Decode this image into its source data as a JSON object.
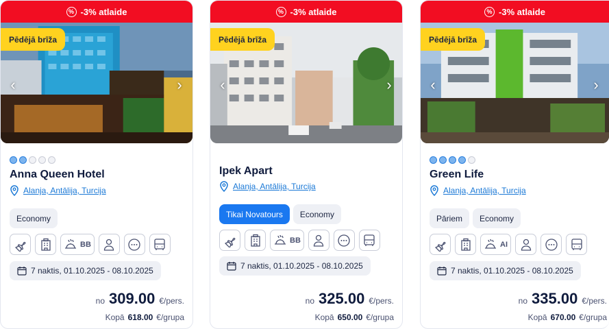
{
  "cards": [
    {
      "discount": "-3% atlaide",
      "badge": "Pēdējā brīža",
      "stars_on": 2,
      "name": "Anna Queen Hotel",
      "location": "Alanja, Antālija, Turcija",
      "chips": [
        "Economy"
      ],
      "board": "BB",
      "dates": "7 naktis, 01.10.2025 - 08.10.2025",
      "price_prefix": "no",
      "price": "309.00",
      "price_unit": "€/pers.",
      "total_label": "Kopā",
      "total": "618.00",
      "total_unit": "€/grupa"
    },
    {
      "discount": "-3% atlaide",
      "badge": "Pēdējā brīža",
      "stars_on": 0,
      "name": "Ipek Apart",
      "location": "Alanja, Antālija, Turcija",
      "chips": [
        "Tikai Novatours",
        "Economy"
      ],
      "board": "BB",
      "dates": "7 naktis, 01.10.2025 - 08.10.2025",
      "price_prefix": "no",
      "price": "325.00",
      "price_unit": "€/pers.",
      "total_label": "Kopā",
      "total": "650.00",
      "total_unit": "€/grupa"
    },
    {
      "discount": "-3% atlaide",
      "badge": "Pēdējā brīža",
      "stars_on": 4,
      "name": "Green Life",
      "location": "Alanja, Antālija, Turcija",
      "chips": [
        "Pāriem",
        "Economy"
      ],
      "board": "AI",
      "dates": "7 naktis, 01.10.2025 - 08.10.2025",
      "price_prefix": "no",
      "price": "335.00",
      "price_unit": "€/pers.",
      "total_label": "Kopā",
      "total": "670.00",
      "total_unit": "€/grupa"
    }
  ],
  "colors": {
    "banner": "#f20d22",
    "badge": "#ffd21f",
    "link": "#1a78d6",
    "chip_highlight": "#1a78f0"
  },
  "icons": [
    "plane-icon",
    "hotel-icon",
    "meal-icon",
    "person-icon",
    "more-icon",
    "bus-icon",
    "calendar-icon",
    "pin-icon",
    "chevron-left-icon",
    "chevron-right-icon"
  ]
}
